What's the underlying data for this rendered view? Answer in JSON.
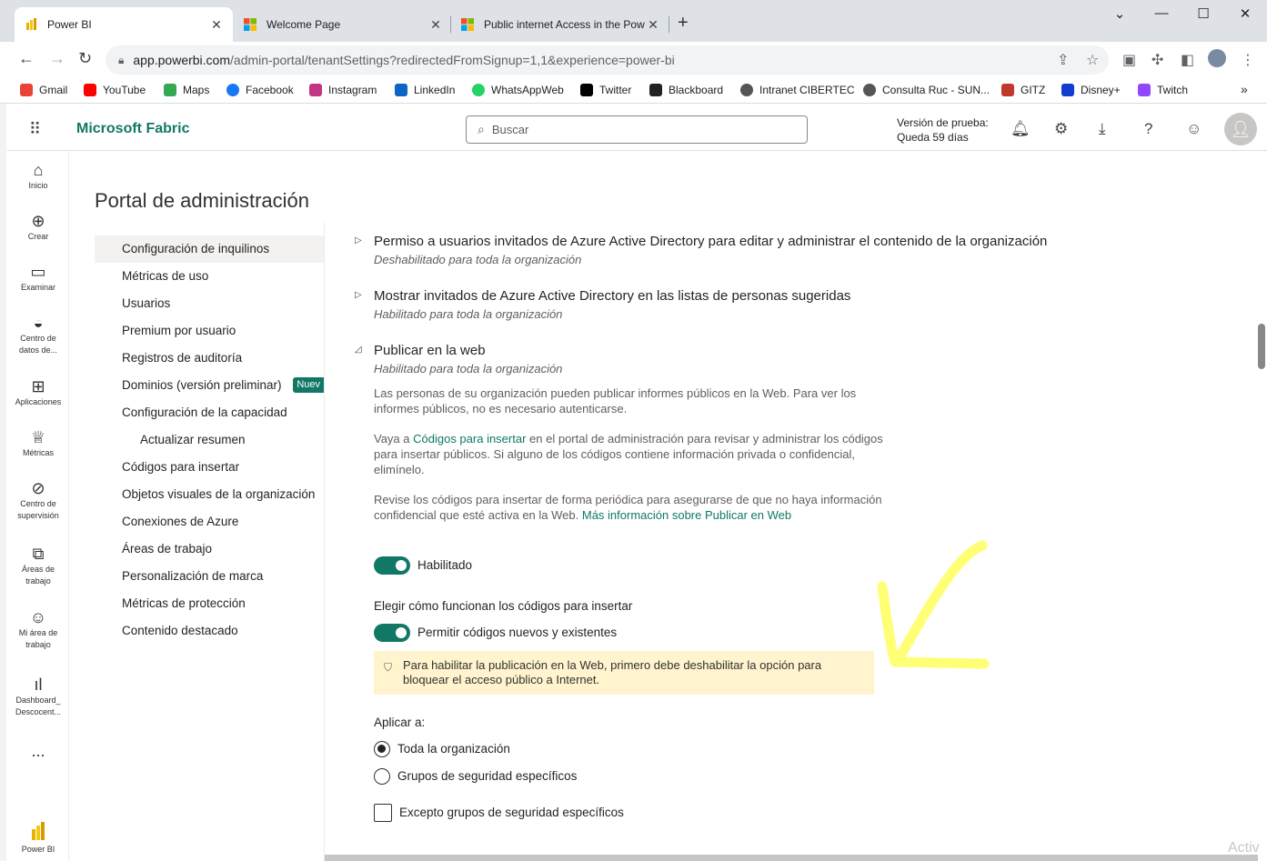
{
  "browser": {
    "tabs": [
      {
        "title": "Power BI",
        "active": true
      },
      {
        "title": "Welcome Page",
        "active": false
      },
      {
        "title": "Public internet Access in the Pow",
        "active": false
      }
    ],
    "url_host": "app.powerbi.com",
    "url_path": "/admin-portal/tenantSettings?redirectedFromSignup=1,1&experience=power-bi",
    "bookmarks": [
      {
        "label": "Gmail",
        "color": "#ea4335"
      },
      {
        "label": "YouTube",
        "color": "#ff0000"
      },
      {
        "label": "Maps",
        "color": "#34a853"
      },
      {
        "label": "Facebook",
        "color": "#1877f2"
      },
      {
        "label": "Instagram",
        "color": "#c13584"
      },
      {
        "label": "LinkedIn",
        "color": "#0a66c2"
      },
      {
        "label": "WhatsAppWeb",
        "color": "#25d366"
      },
      {
        "label": "Twitter",
        "color": "#000000"
      },
      {
        "label": "Blackboard",
        "color": "#222222"
      },
      {
        "label": "Intranet CIBERTEC",
        "color": "#555555"
      },
      {
        "label": "Consulta Ruc - SUN...",
        "color": "#555555"
      },
      {
        "label": "GITZ",
        "color": "#c0392b"
      },
      {
        "label": "Disney+",
        "color": "#113ccf"
      },
      {
        "label": "Twitch",
        "color": "#9146ff"
      }
    ],
    "bookmarks_more": "»"
  },
  "header": {
    "brand": "Microsoft Fabric",
    "search_placeholder": "Buscar",
    "trial_line1": "Versión de prueba:",
    "trial_line2": "Queda 59 días"
  },
  "rail": [
    {
      "label": "Inicio",
      "icon": "⌂"
    },
    {
      "label": "Crear",
      "icon": "⊕"
    },
    {
      "label": "Examinar",
      "icon": "▭"
    },
    {
      "label": "Centro de datos de...",
      "icon": "◒"
    },
    {
      "label": "Aplicaciones",
      "icon": "⊞"
    },
    {
      "label": "Métricas",
      "icon": "♕"
    },
    {
      "label": "Centro de supervisión",
      "icon": "⊘"
    },
    {
      "label": "Áreas de trabajo",
      "icon": "⧉"
    },
    {
      "label": "Mi área de trabajo",
      "icon": "☺"
    },
    {
      "label": "Dashboard_ Descocent...",
      "icon": "ıl"
    },
    {
      "label": "...",
      "icon": ""
    },
    {
      "label": "Power BI",
      "icon": ""
    }
  ],
  "page": {
    "title": "Portal de administración"
  },
  "admin_nav": {
    "items": [
      "Configuración de inquilinos",
      "Métricas de uso",
      "Usuarios",
      "Premium por usuario",
      "Registros de auditoría",
      "Dominios (versión preliminar)",
      "Configuración de la capacidad",
      "Actualizar resumen",
      "Códigos para insertar",
      "Objetos visuales de la organización",
      "Conexiones de Azure",
      "Áreas de trabajo",
      "Personalización de marca",
      "Métricas de protección",
      "Contenido destacado"
    ],
    "badge": "Nuev"
  },
  "settings": {
    "s1_title": "Permiso a usuarios invitados de Azure Active Directory para editar y administrar el contenido de la organización",
    "s1_status": "Deshabilitado para toda la organización",
    "s2_title": "Mostrar invitados de Azure Active Directory en las listas de personas sugeridas",
    "s2_status": "Habilitado para toda la organización",
    "s3_title": "Publicar en la web",
    "s3_status": "Habilitado para toda la organización",
    "p1": "Las personas de su organización pueden publicar informes públicos en la Web. Para ver los informes públicos, no es necesario autenticarse.",
    "p2_pre": "Vaya a ",
    "p2_link": "Códigos para insertar",
    "p2_post": " en el portal de administración para revisar y administrar los códigos para insertar públicos. Si alguno de los códigos contiene información privada o confidencial, elimínelo.",
    "p3_pre": "Revise los códigos para insertar de forma periódica para asegurarse de que no haya información confidencial que esté activa en la Web. ",
    "p3_link": "Más información sobre Publicar en Web",
    "toggle1_label": "Habilitado",
    "embed_heading": "Elegir cómo funcionan los códigos para insertar",
    "toggle2_label": "Permitir códigos nuevos y existentes",
    "warning": "Para habilitar la publicación en la Web, primero debe deshabilitar la opción para bloquear el acceso público a Internet.",
    "apply_heading": "Aplicar a:",
    "radio1": "Toda la organización",
    "radio2": "Grupos de seguridad específicos",
    "checkbox": "Excepto grupos de seguridad específicos"
  },
  "watermark": "Activ",
  "colors": {
    "accent": "#117865",
    "warning_bg": "#fff4ce",
    "annotation": "#ffff66"
  }
}
